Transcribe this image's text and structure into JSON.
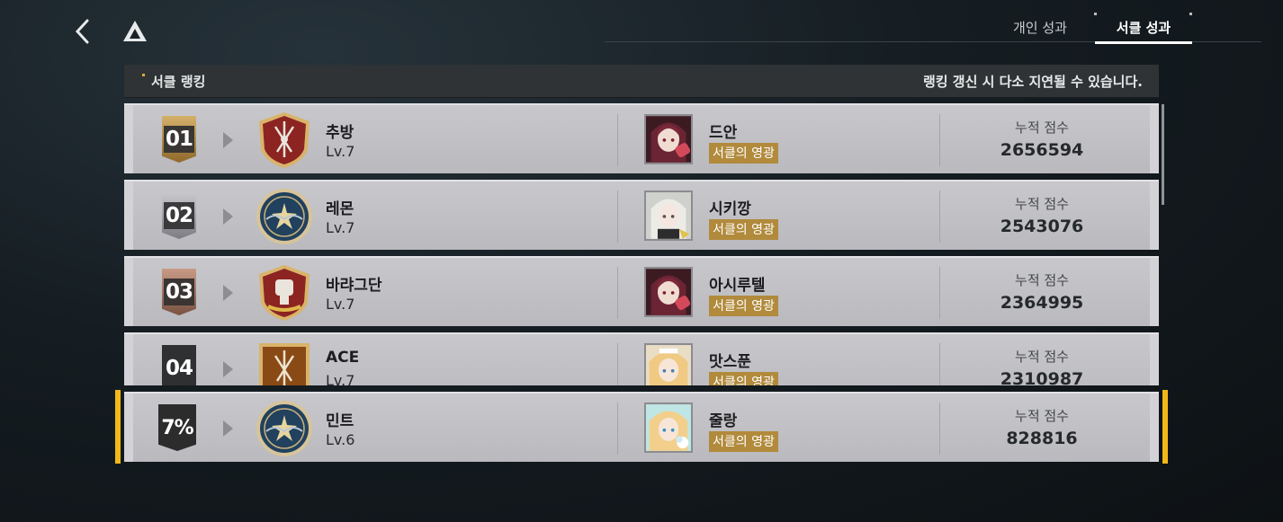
{
  "header": {
    "tabs": [
      {
        "label": "개인 성과",
        "active": false
      },
      {
        "label": "서클 성과",
        "active": true
      }
    ]
  },
  "panel": {
    "title": "서클 랭킹",
    "note": "랭킹 갱신 시 다소 지연될 수 있습니다."
  },
  "score_label": "누적 점수",
  "rows": [
    {
      "rank": "01",
      "badge": "gold",
      "emblem": "sword-crest-emblem",
      "circle": "추방",
      "level": "Lv.7",
      "leader": "드안",
      "leader_title": "서클의 영광",
      "score": "2656594"
    },
    {
      "rank": "02",
      "badge": "silver",
      "emblem": "star-crest-emblem",
      "circle": "레몬",
      "level": "Lv.7",
      "leader": "시키깡",
      "leader_title": "서클의 영광",
      "score": "2543076"
    },
    {
      "rank": "03",
      "badge": "bronze",
      "emblem": "fist-crest-emblem",
      "circle": "바랴그단",
      "level": "Lv.7",
      "leader": "아시루텔",
      "leader_title": "서클의 영광",
      "score": "2364995"
    },
    {
      "rank": "04",
      "badge": "dark",
      "emblem": "sword-crest-emblem",
      "circle": "ACE",
      "level": "Lv.7",
      "leader": "맛스푼",
      "leader_title": "서클의 영광",
      "score": "2310987"
    }
  ],
  "my_circle": {
    "rank": "7%",
    "emblem": "star-crest-emblem",
    "circle": "민트",
    "level": "Lv.6",
    "leader": "줄랑",
    "leader_title": "서클의 영광",
    "score": "828816"
  },
  "colors": {
    "accent_yellow": "#f2b818",
    "title_tag": "#b18a3c",
    "row_bg": "#c2c2c6"
  }
}
